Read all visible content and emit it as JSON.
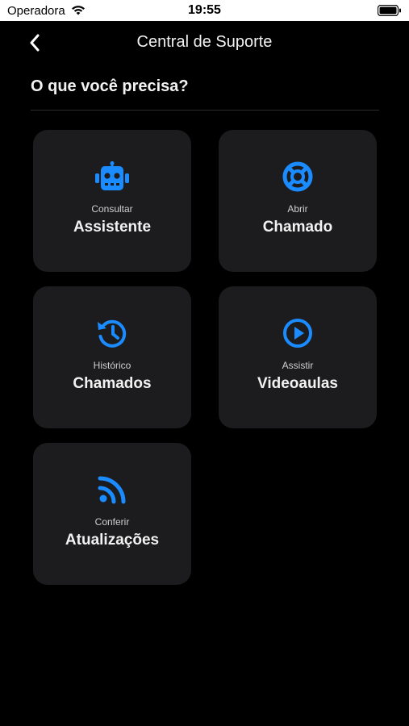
{
  "status_bar": {
    "carrier": "Operadora",
    "time": "19:55"
  },
  "nav": {
    "title": "Central de Suporte"
  },
  "section": {
    "heading": "O que você precisa?"
  },
  "cards": [
    {
      "sub": "Consultar",
      "label": "Assistente",
      "icon": "robot-icon"
    },
    {
      "sub": "Abrir",
      "label": "Chamado",
      "icon": "life-ring-icon"
    },
    {
      "sub": "Histórico",
      "label": "Chamados",
      "icon": "history-icon"
    },
    {
      "sub": "Assistir",
      "label": "Videoaulas",
      "icon": "play-circle-icon"
    },
    {
      "sub": "Conferir",
      "label": "Atualizações",
      "icon": "rss-icon"
    }
  ],
  "colors": {
    "accent": "#1a8cff",
    "card": "#1c1c1e",
    "background": "#000000"
  }
}
